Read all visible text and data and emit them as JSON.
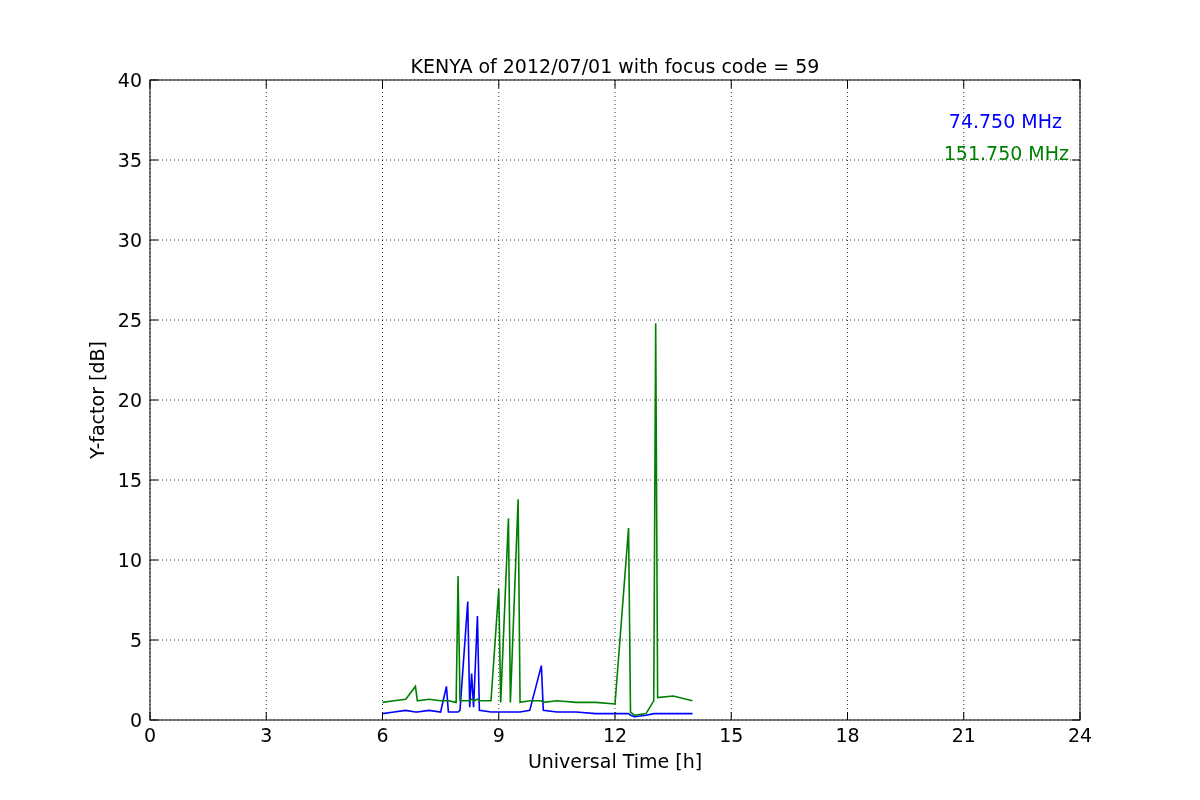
{
  "figure": {
    "chart_data": {
      "type": "line",
      "title": "KENYA of 2012/07/01 with focus code = 59",
      "xlabel": "Universal Time [h]",
      "ylabel": "Y-factor [dB]",
      "x": [
        6.0,
        6.3,
        6.6,
        6.85,
        6.9,
        7.2,
        7.5,
        7.65,
        7.7,
        7.9,
        7.95,
        8.0,
        8.2,
        8.25,
        8.3,
        8.35,
        8.45,
        8.5,
        8.8,
        9.0,
        9.05,
        9.25,
        9.3,
        9.5,
        9.55,
        9.8,
        10.1,
        10.15,
        10.5,
        11.0,
        11.5,
        12.0,
        12.35,
        12.4,
        12.5,
        12.8,
        13.0,
        13.05,
        13.1,
        13.5,
        14.0
      ],
      "series": [
        {
          "name": "74.750 MHz",
          "color": "#0000ff",
          "values": [
            0.4,
            0.5,
            0.6,
            0.5,
            0.5,
            0.6,
            0.5,
            2.1,
            0.5,
            0.5,
            0.5,
            0.6,
            7.4,
            0.8,
            2.9,
            0.8,
            6.5,
            0.6,
            0.5,
            0.5,
            0.5,
            0.5,
            0.5,
            0.5,
            0.5,
            0.6,
            3.4,
            0.6,
            0.5,
            0.5,
            0.4,
            0.4,
            0.4,
            0.3,
            0.2,
            0.3,
            0.4,
            0.4,
            0.4,
            0.4,
            0.4
          ]
        },
        {
          "name": "151.750 MHz",
          "color": "#008000",
          "values": [
            1.1,
            1.2,
            1.3,
            2.1,
            1.2,
            1.3,
            1.2,
            1.2,
            1.2,
            1.1,
            9.0,
            1.2,
            1.2,
            1.2,
            1.3,
            1.2,
            1.3,
            1.2,
            1.2,
            8.2,
            1.1,
            12.6,
            1.1,
            13.8,
            1.1,
            1.2,
            1.2,
            1.1,
            1.2,
            1.1,
            1.1,
            1.0,
            12.0,
            0.5,
            0.3,
            0.4,
            1.2,
            24.8,
            1.4,
            1.5,
            1.2
          ]
        }
      ],
      "grid": true,
      "xlim": [
        0,
        24
      ],
      "ylim": [
        0,
        40
      ],
      "xticks": [
        0,
        3,
        6,
        9,
        12,
        15,
        18,
        21,
        24
      ],
      "yticks": [
        0,
        5,
        10,
        15,
        20,
        25,
        30,
        35,
        40
      ]
    }
  }
}
